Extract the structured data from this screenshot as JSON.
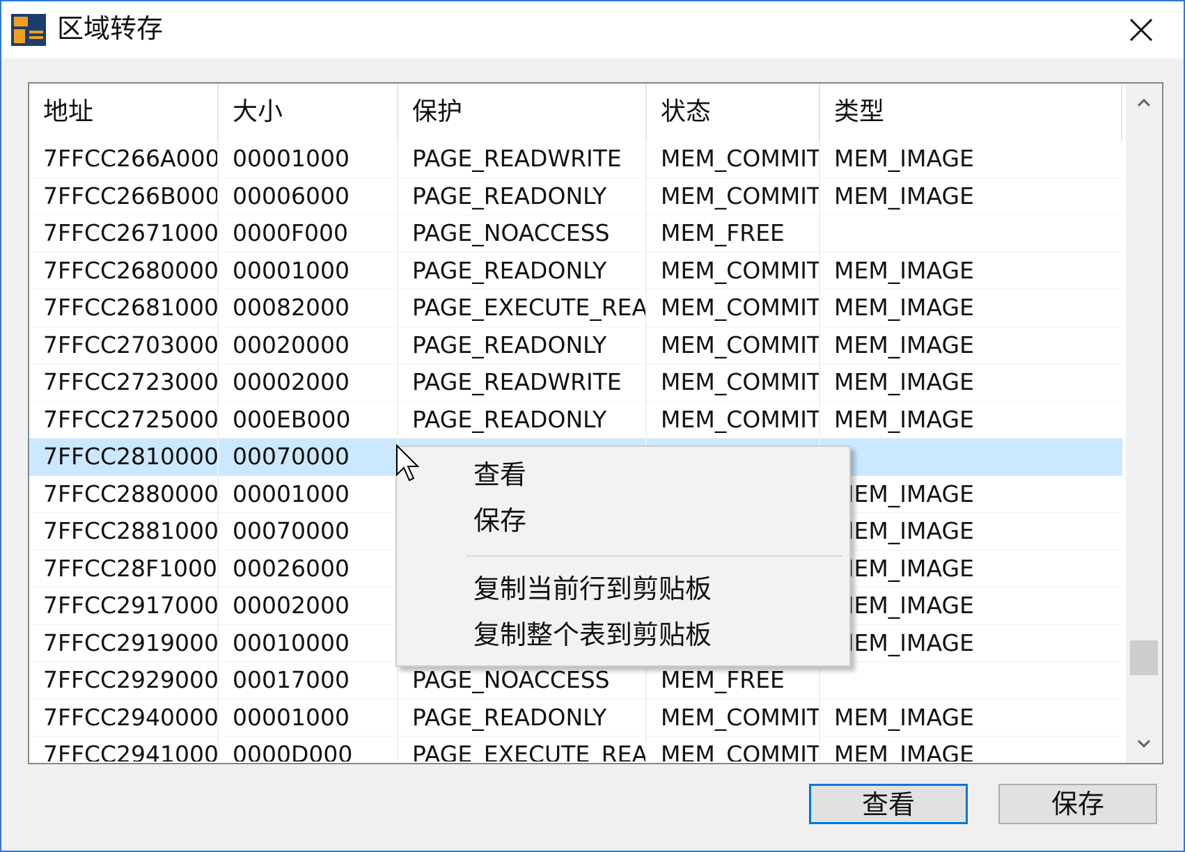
{
  "window": {
    "title": "区域转存",
    "icon": "app-icon",
    "close_icon": "close-icon"
  },
  "table": {
    "columns": [
      "地址",
      "大小",
      "保护",
      "状态",
      "类型"
    ],
    "rows": [
      [
        "7FFCC266A000",
        "00001000",
        "PAGE_READWRITE",
        "MEM_COMMIT",
        "MEM_IMAGE"
      ],
      [
        "7FFCC266B000",
        "00006000",
        "PAGE_READONLY",
        "MEM_COMMIT",
        "MEM_IMAGE"
      ],
      [
        "7FFCC2671000",
        "0000F000",
        "PAGE_NOACCESS",
        "MEM_FREE",
        ""
      ],
      [
        "7FFCC2680000",
        "00001000",
        "PAGE_READONLY",
        "MEM_COMMIT",
        "MEM_IMAGE"
      ],
      [
        "7FFCC2681000",
        "00082000",
        "PAGE_EXECUTE_READ",
        "MEM_COMMIT",
        "MEM_IMAGE"
      ],
      [
        "7FFCC2703000",
        "00020000",
        "PAGE_READONLY",
        "MEM_COMMIT",
        "MEM_IMAGE"
      ],
      [
        "7FFCC2723000",
        "00002000",
        "PAGE_READWRITE",
        "MEM_COMMIT",
        "MEM_IMAGE"
      ],
      [
        "7FFCC2725000",
        "000EB000",
        "PAGE_READONLY",
        "MEM_COMMIT",
        "MEM_IMAGE"
      ],
      [
        "7FFCC2810000",
        "00070000",
        "",
        "",
        ""
      ],
      [
        "7FFCC2880000",
        "00001000",
        "",
        "",
        "MEM_IMAGE"
      ],
      [
        "7FFCC2881000",
        "00070000",
        "",
        "",
        "MEM_IMAGE"
      ],
      [
        "7FFCC28F1000",
        "00026000",
        "",
        "",
        "MEM_IMAGE"
      ],
      [
        "7FFCC2917000",
        "00002000",
        "",
        "",
        "MEM_IMAGE"
      ],
      [
        "7FFCC2919000",
        "00010000",
        "",
        "",
        "MEM_IMAGE"
      ],
      [
        "7FFCC2929000",
        "00017000",
        "PAGE_NOACCESS",
        "MEM_FREE",
        ""
      ],
      [
        "7FFCC2940000",
        "00001000",
        "PAGE_READONLY",
        "MEM_COMMIT",
        "MEM_IMAGE"
      ],
      [
        "7FFCC2941000",
        "0000D000",
        "PAGE_EXECUTE_READ",
        "MEM_COMMIT",
        "MEM_IMAGE"
      ]
    ],
    "selected_row": 8
  },
  "context_menu": {
    "items": [
      "查看",
      "保存",
      "复制当前行到剪贴板",
      "复制整个表到剪贴板"
    ]
  },
  "buttons": {
    "view": "查看",
    "save": "保存"
  },
  "colors": {
    "accent": "#0078d7",
    "selection": "#cce8ff",
    "border": "#2b79d7"
  }
}
